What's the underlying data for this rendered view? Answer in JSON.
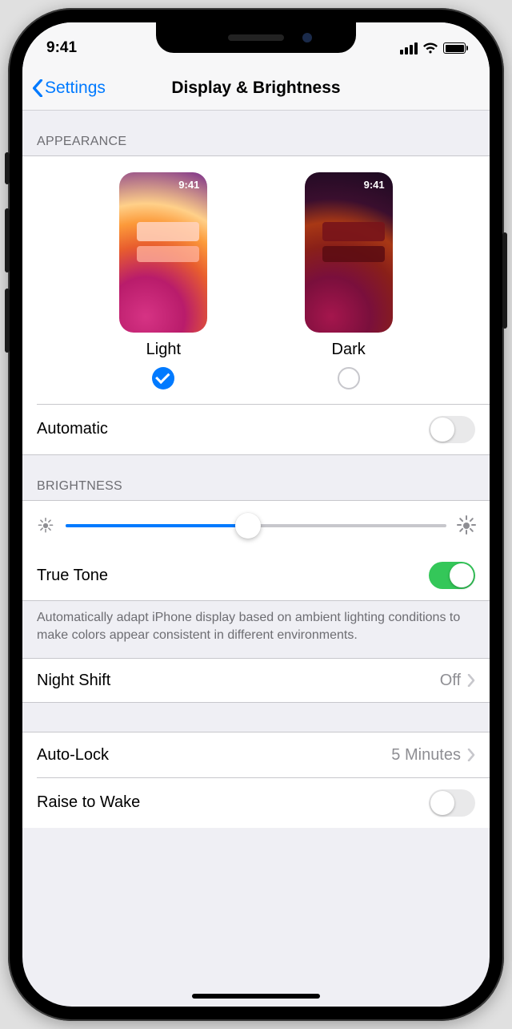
{
  "status": {
    "time": "9:41"
  },
  "nav": {
    "back_label": "Settings",
    "title": "Display & Brightness"
  },
  "appearance": {
    "section_header": "APPEARANCE",
    "thumb_time": "9:41",
    "light_label": "Light",
    "dark_label": "Dark",
    "selected": "light",
    "automatic_label": "Automatic",
    "automatic_on": false
  },
  "brightness": {
    "section_header": "BRIGHTNESS",
    "value_percent": 48,
    "true_tone_label": "True Tone",
    "true_tone_on": true,
    "true_tone_footer": "Automatically adapt iPhone display based on ambient lighting conditions to make colors appear consistent in different environments."
  },
  "night_shift": {
    "label": "Night Shift",
    "value": "Off"
  },
  "auto_lock": {
    "label": "Auto-Lock",
    "value": "5 Minutes"
  },
  "raise_to_wake": {
    "label": "Raise to Wake",
    "on": false
  }
}
